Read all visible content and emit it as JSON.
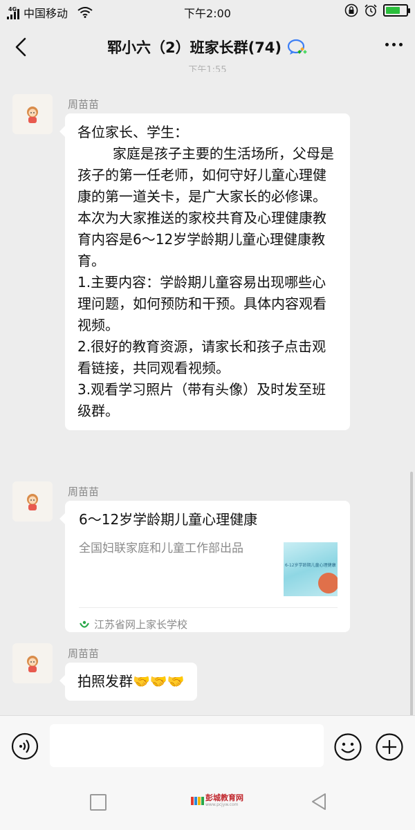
{
  "status_bar": {
    "network": "4G",
    "carrier": "中国移动",
    "time": "下午2:00"
  },
  "header": {
    "title": "郓小六（2）班家长群(74)",
    "timestamp_partial": "下午1:55"
  },
  "messages": [
    {
      "sender": "周苗苗",
      "type": "text",
      "text": "各位家长、学生：\n        家庭是孩子主要的生活场所，父母是孩子的第一任老师，如何守好儿童心理健康的第一道关卡，是广大家长的必修课。本次为大家推送的家校共育及心理健康教育内容是6～12岁学龄期儿童心理健康教育。\n1.主要内容：学龄期儿童容易出现哪些心理问题，如何预防和干预。具体内容观看视频。\n2.很好的教育资源，请家长和孩子点击观看链接，共同观看视频。\n3.观看学习照片（带有头像）及时发至班级群。"
    },
    {
      "sender": "周苗苗",
      "type": "link_card",
      "card_title": "6～12岁学龄期儿童心理健康",
      "card_desc": "全国妇联家庭和儿童工作部出品",
      "thumb_text": "6-12岁学龄期儿童心理健康",
      "source": "江苏省网上家长学校"
    },
    {
      "sender": "周苗苗",
      "type": "text",
      "text": "拍照发群🤝🤝🤝"
    }
  ],
  "input": {
    "value": "",
    "placeholder": ""
  },
  "watermark": {
    "text": "彭城教育网",
    "url": "www.pcjyw.com"
  },
  "colors": {
    "background": "#ededed",
    "bubble": "#ffffff",
    "battery": "#2bbf3c",
    "chat_icon_blue": "#3d7ff5"
  }
}
